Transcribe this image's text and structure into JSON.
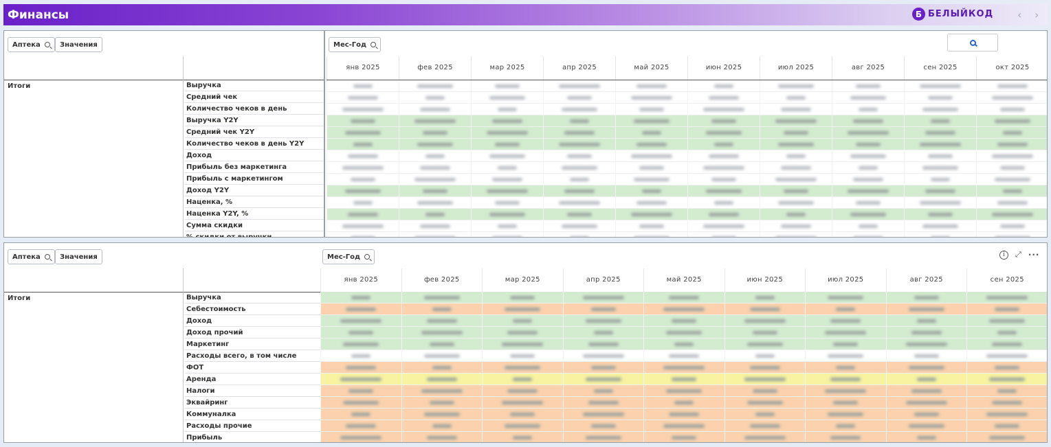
{
  "header": {
    "title": "Финансы",
    "logo_mark": "Б",
    "logo_text": "БЕЛЫЙКОД",
    "prev": "‹",
    "next": "›"
  },
  "colors": {
    "green": "#d3ecd0",
    "orange": "#fbd2ad",
    "yellow": "#f7f3a0",
    "white": "#ffffff"
  },
  "panel1": {
    "btn_apteka": "Аптека",
    "btn_values": "Значения",
    "btn_period": "Мес-Год",
    "itogi": "Итоги",
    "months": [
      "янв 2025",
      "фев 2025",
      "мар 2025",
      "апр 2025",
      "май 2025",
      "июн 2025",
      "июл 2025",
      "авг 2025",
      "сен 2025",
      "окт 2025"
    ],
    "rows": [
      {
        "label": "Выручка",
        "tone": "white"
      },
      {
        "label": "Средний чек",
        "tone": "white"
      },
      {
        "label": "Количество чеков в день",
        "tone": "white"
      },
      {
        "label": "Выручка Y2Y",
        "tone": "green"
      },
      {
        "label": "Средний чек Y2Y",
        "tone": "green"
      },
      {
        "label": "Количество чеков в день Y2Y",
        "tone": "green"
      },
      {
        "label": "Доход",
        "tone": "white"
      },
      {
        "label": "Прибыль без маркетинга",
        "tone": "white"
      },
      {
        "label": "Прибыль с маркетингом",
        "tone": "white"
      },
      {
        "label": "Доход Y2Y",
        "tone": "green"
      },
      {
        "label": "Наценка, %",
        "tone": "white"
      },
      {
        "label": "Наценка Y2Y, %",
        "tone": "green"
      },
      {
        "label": "Сумма скидки",
        "tone": "white"
      },
      {
        "label": "% скидки от выручки",
        "tone": "white"
      }
    ]
  },
  "panel2": {
    "btn_apteka": "Аптека",
    "btn_values": "Значения",
    "btn_period": "Мес-Год",
    "itogi": "Итоги",
    "months": [
      "янв 2025",
      "фев 2025",
      "мар 2025",
      "апр 2025",
      "май 2025",
      "июн 2025",
      "июл 2025",
      "авг 2025",
      "сен 2025"
    ],
    "rows": [
      {
        "label": "Выручка",
        "tone": "green"
      },
      {
        "label": "Себестоимость",
        "tone": "orange"
      },
      {
        "label": "Доход",
        "tone": "green"
      },
      {
        "label": "Доход прочий",
        "tone": "green"
      },
      {
        "label": "Маркетинг",
        "tone": "green"
      },
      {
        "label": "Расходы всего, в том числе",
        "tone": "white"
      },
      {
        "label": "ФОТ",
        "tone": "orange"
      },
      {
        "label": "Аренда",
        "tone": "yellow"
      },
      {
        "label": "Налоги",
        "tone": "orange"
      },
      {
        "label": "Эквайринг",
        "tone": "orange"
      },
      {
        "label": "Коммуналка",
        "tone": "orange"
      },
      {
        "label": "Расходы прочие",
        "tone": "orange"
      },
      {
        "label": "Прибыль",
        "tone": "orange"
      }
    ],
    "tools": {
      "info": "i",
      "expand": "⤢",
      "more": "···"
    }
  }
}
